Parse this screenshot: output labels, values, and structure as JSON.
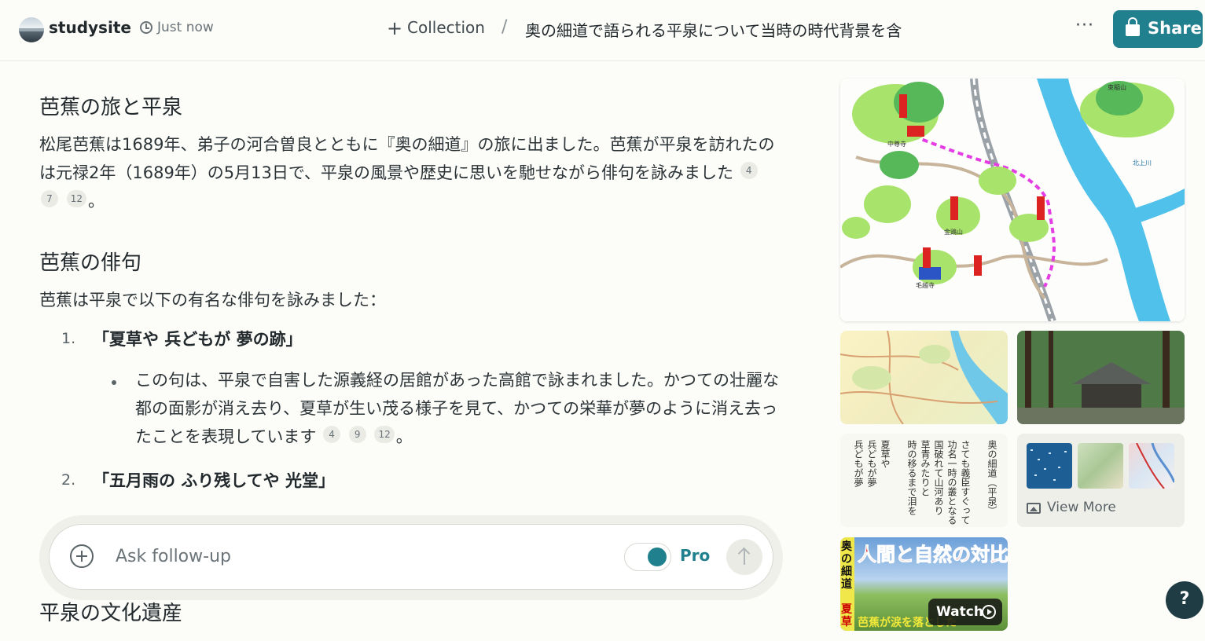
{
  "header": {
    "site_name": "studysite",
    "timestamp": "Just now",
    "collection_label": "Collection",
    "separator": "/",
    "thread_title": "奥の細道で語られる平泉について当時の時代背景を含…",
    "share_label": "Share",
    "more_label": "···"
  },
  "article": {
    "section1": {
      "heading": "芭蕉の旅と平泉",
      "text_line1": "松尾芭蕉は1689年、弟子の河合曽良とともに『奥の細道』の旅に出ました。芭蕉が平泉を訪れたの",
      "text_line2": "は元禄2年（1689年）の5月13日で、平泉の風景や歴史に思いを馳せながら俳句を詠みました",
      "cites": [
        "4",
        "7",
        "12"
      ],
      "tail": "。"
    },
    "section2": {
      "heading": "芭蕉の俳句",
      "intro": "芭蕉は平泉で以下の有名な俳句を詠みました：",
      "items": [
        {
          "num": "1.",
          "haiku": "「夏草や 兵どもが 夢の跡」",
          "desc_line1": "この句は、平泉で自害した源義経の居館があった高館で詠まれました。かつての壮麗な",
          "desc_line2": "都の面影が消え去り、夏草が生い茂る様子を見て、かつての栄華が夢のように消え去っ",
          "desc_line3": "たことを表現しています",
          "cites": [
            "4",
            "9",
            "12"
          ],
          "tail": "。"
        },
        {
          "num": "2.",
          "haiku": "「五月雨の ふり残してや 光堂」"
        }
      ]
    },
    "section3": {
      "heading": "平泉の文化遺産"
    }
  },
  "followup": {
    "placeholder": "Ask follow-up",
    "pro_label": "Pro"
  },
  "media": {
    "map_labels": [
      "中尊寺",
      "毛越寺",
      "金鶏山",
      "北上川",
      "束稲山"
    ],
    "text_image_columns": [
      "奥の細道（平泉）",
      "さても義臣すぐって",
      "功名一時の叢となる",
      "国破れて山河あり",
      "草青みたりと",
      "時の移るまで泪を",
      "夏草や",
      "兵どもが夢",
      "兵どもが夢"
    ],
    "view_more_label": "View More",
    "video": {
      "title": "人間と自然の対比",
      "side_top": "奥の細道",
      "side_bottom": "夏草",
      "caption": "芭蕉が涙を落とした",
      "watch_label": "Watch"
    }
  },
  "help_label": "?",
  "colors": {
    "accent": "#21808d",
    "background": "#fcfcf9",
    "help_button": "#1f3b44"
  }
}
